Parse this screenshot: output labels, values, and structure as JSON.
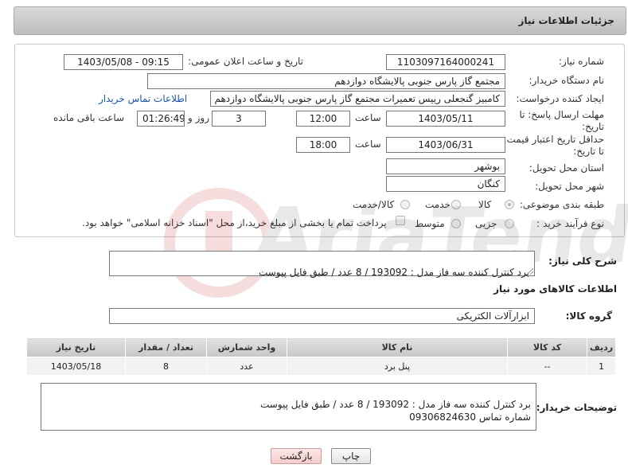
{
  "header": {
    "title": "جزئیات اطلاعات نیاز"
  },
  "form": {
    "need_number": {
      "label": "شماره نیاز:",
      "value": "1103097164000241"
    },
    "announce": {
      "label": "تاریخ و ساعت اعلان عمومی:",
      "value": "1403/05/08 - 09:15"
    },
    "buyer_org": {
      "label": "نام دستگاه خریدار:",
      "value": "مجتمع گاز پارس جنوبی  پالایشگاه دوازدهم"
    },
    "requester": {
      "label": "ایجاد کننده درخواست:",
      "value": "کامبیز گنجعلی رییس تعمیرات مجتمع گاز پارس جنوبی  پالایشگاه دوازدهم",
      "contact_link": "اطلاعات تماس خریدار"
    },
    "reply_deadline": {
      "label": "مهلت ارسال پاسخ: تا تاریخ:",
      "date": "1403/05/11",
      "time_label": "ساعت",
      "time": "12:00",
      "days": "3",
      "days_label": "روز و",
      "remaining": "01:26:49",
      "remaining_label": "ساعت باقی مانده"
    },
    "price_validity": {
      "label": "حداقل تاریخ اعتبار قیمت: تا تاریخ:",
      "date": "1403/06/31",
      "time_label": "ساعت",
      "time": "18:00"
    },
    "province": {
      "label": "استان محل تحویل:",
      "value": "بوشهر"
    },
    "city": {
      "label": "شهر محل تحویل:",
      "value": "کنگان"
    },
    "category": {
      "label": "طبقه بندی موضوعی:",
      "options": [
        {
          "label": "کالا",
          "selected": true
        },
        {
          "label": "خدمت",
          "selected": false
        },
        {
          "label": "کالا/خدمت",
          "selected": false
        }
      ]
    },
    "purchase_type": {
      "label": "نوع فرآیند خرید :",
      "options": [
        {
          "label": "جزیی",
          "selected": false
        },
        {
          "label": "متوسط",
          "selected": false
        }
      ],
      "payment_note": "پرداخت تمام یا بخشی از مبلغ خرید،از محل \"اسناد خزانه اسلامی\" خواهد بود."
    }
  },
  "description": {
    "label": "شرح کلی نیاز:",
    "value": "برد کنترل کننده سه فاز مدل : 193092 / 8 عدد / طبق فایل پیوست"
  },
  "goods": {
    "section_title": "اطلاعات کالاهای مورد نیاز",
    "group_label": "گروه کالا:",
    "group_value": "ابزارآلات الکتریکی",
    "table": {
      "headers": [
        "ردیف",
        "کد کالا",
        "نام کالا",
        "واحد شمارش",
        "تعداد / مقدار",
        "تاریخ نیاز"
      ],
      "rows": [
        [
          "1",
          "--",
          "پنل برد",
          "عدد",
          "8",
          "1403/05/18"
        ]
      ]
    }
  },
  "buyer_notes": {
    "label": "توضیحات خریدار:",
    "value": "برد کنترل کننده سه فاز مدل : 193092 / 8 عدد / طبق فایل پیوست\nشماره تماس 09306824630"
  },
  "buttons": {
    "print": "چاپ",
    "back": "بازگشت"
  },
  "watermark": "AriaTender.net"
}
